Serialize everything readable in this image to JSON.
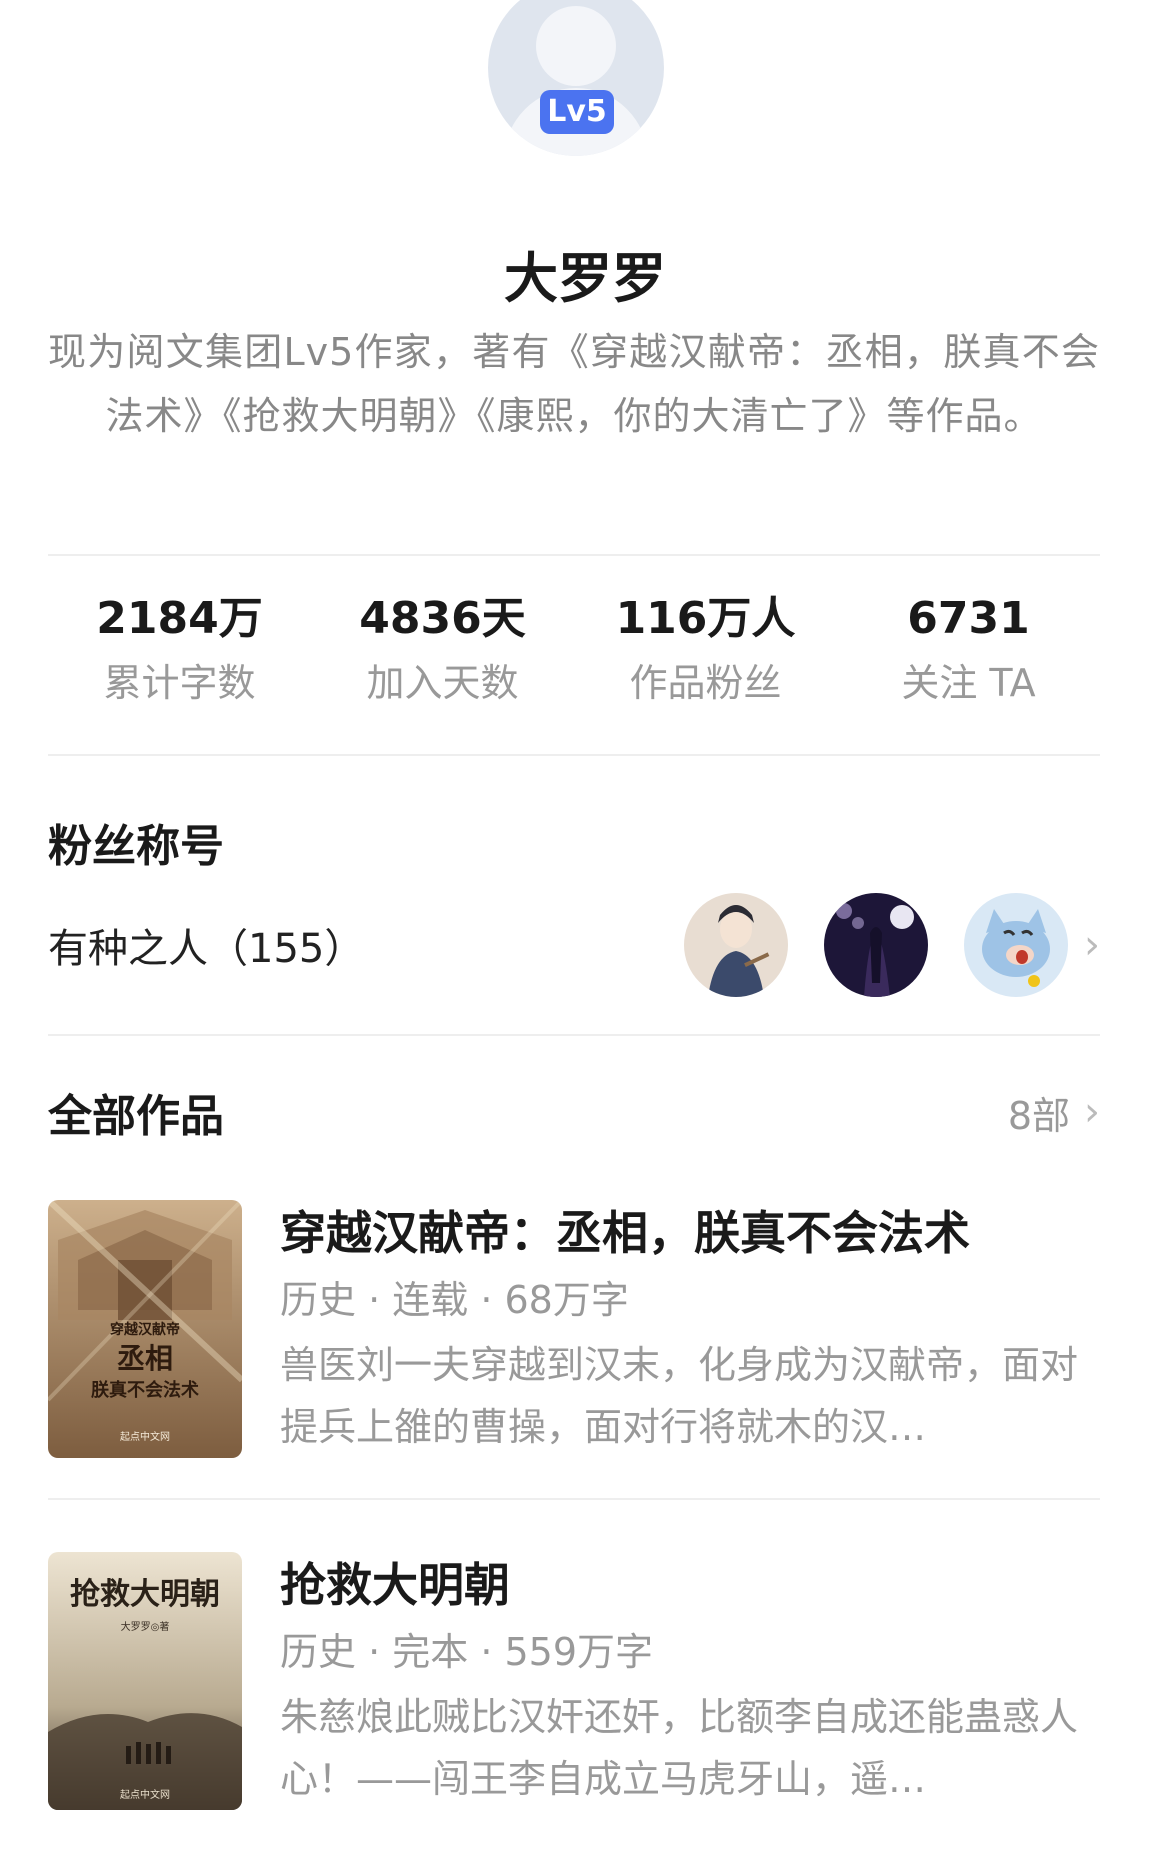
{
  "profile": {
    "level_badge": "Lv5",
    "name": "大罗罗",
    "bio": "现为阅文集团Lv5作家，著有《穿越汉献帝：丞相，朕真不会法术》《抢救大明朝》《康熙，你的大清亡了》等作品。"
  },
  "stats": [
    {
      "value": "2184万",
      "label": "累计字数"
    },
    {
      "value": "4836天",
      "label": "加入天数"
    },
    {
      "value": "116万人",
      "label": "作品粉丝"
    },
    {
      "value": "6731",
      "label": "关注 TA"
    }
  ],
  "fan_title": {
    "heading": "粉丝称号",
    "title_text": "有种之人（155）",
    "chevron": "›"
  },
  "works": {
    "heading": "全部作品",
    "count": "8部",
    "chevron": "›",
    "items": [
      {
        "title": "穿越汉献帝：丞相，朕真不会法术",
        "meta": "历史 · 连载 · 68万字",
        "desc": "兽医刘一夫穿越到汉末，化身成为汉献帝，面对提兵上雒的曹操，面对行将就木的汉…",
        "cover_text": [
          "穿越汉献帝",
          "丞相",
          "朕真不会法术",
          "起点中文网"
        ]
      },
      {
        "title": "抢救大明朝",
        "meta": "历史 · 完本 · 559万字",
        "desc": "朱慈烺此贼比汉奸还奸，比额李自成还能蛊惑人心！——闯王李自成立马虎牙山，遥…",
        "cover_text": [
          "抢救大明朝",
          "大罗罗◎著",
          "起点中文网"
        ]
      }
    ]
  },
  "colors": {
    "badge": "#4b73f0",
    "muted_text": "#999999",
    "divider": "#eeeeee"
  }
}
